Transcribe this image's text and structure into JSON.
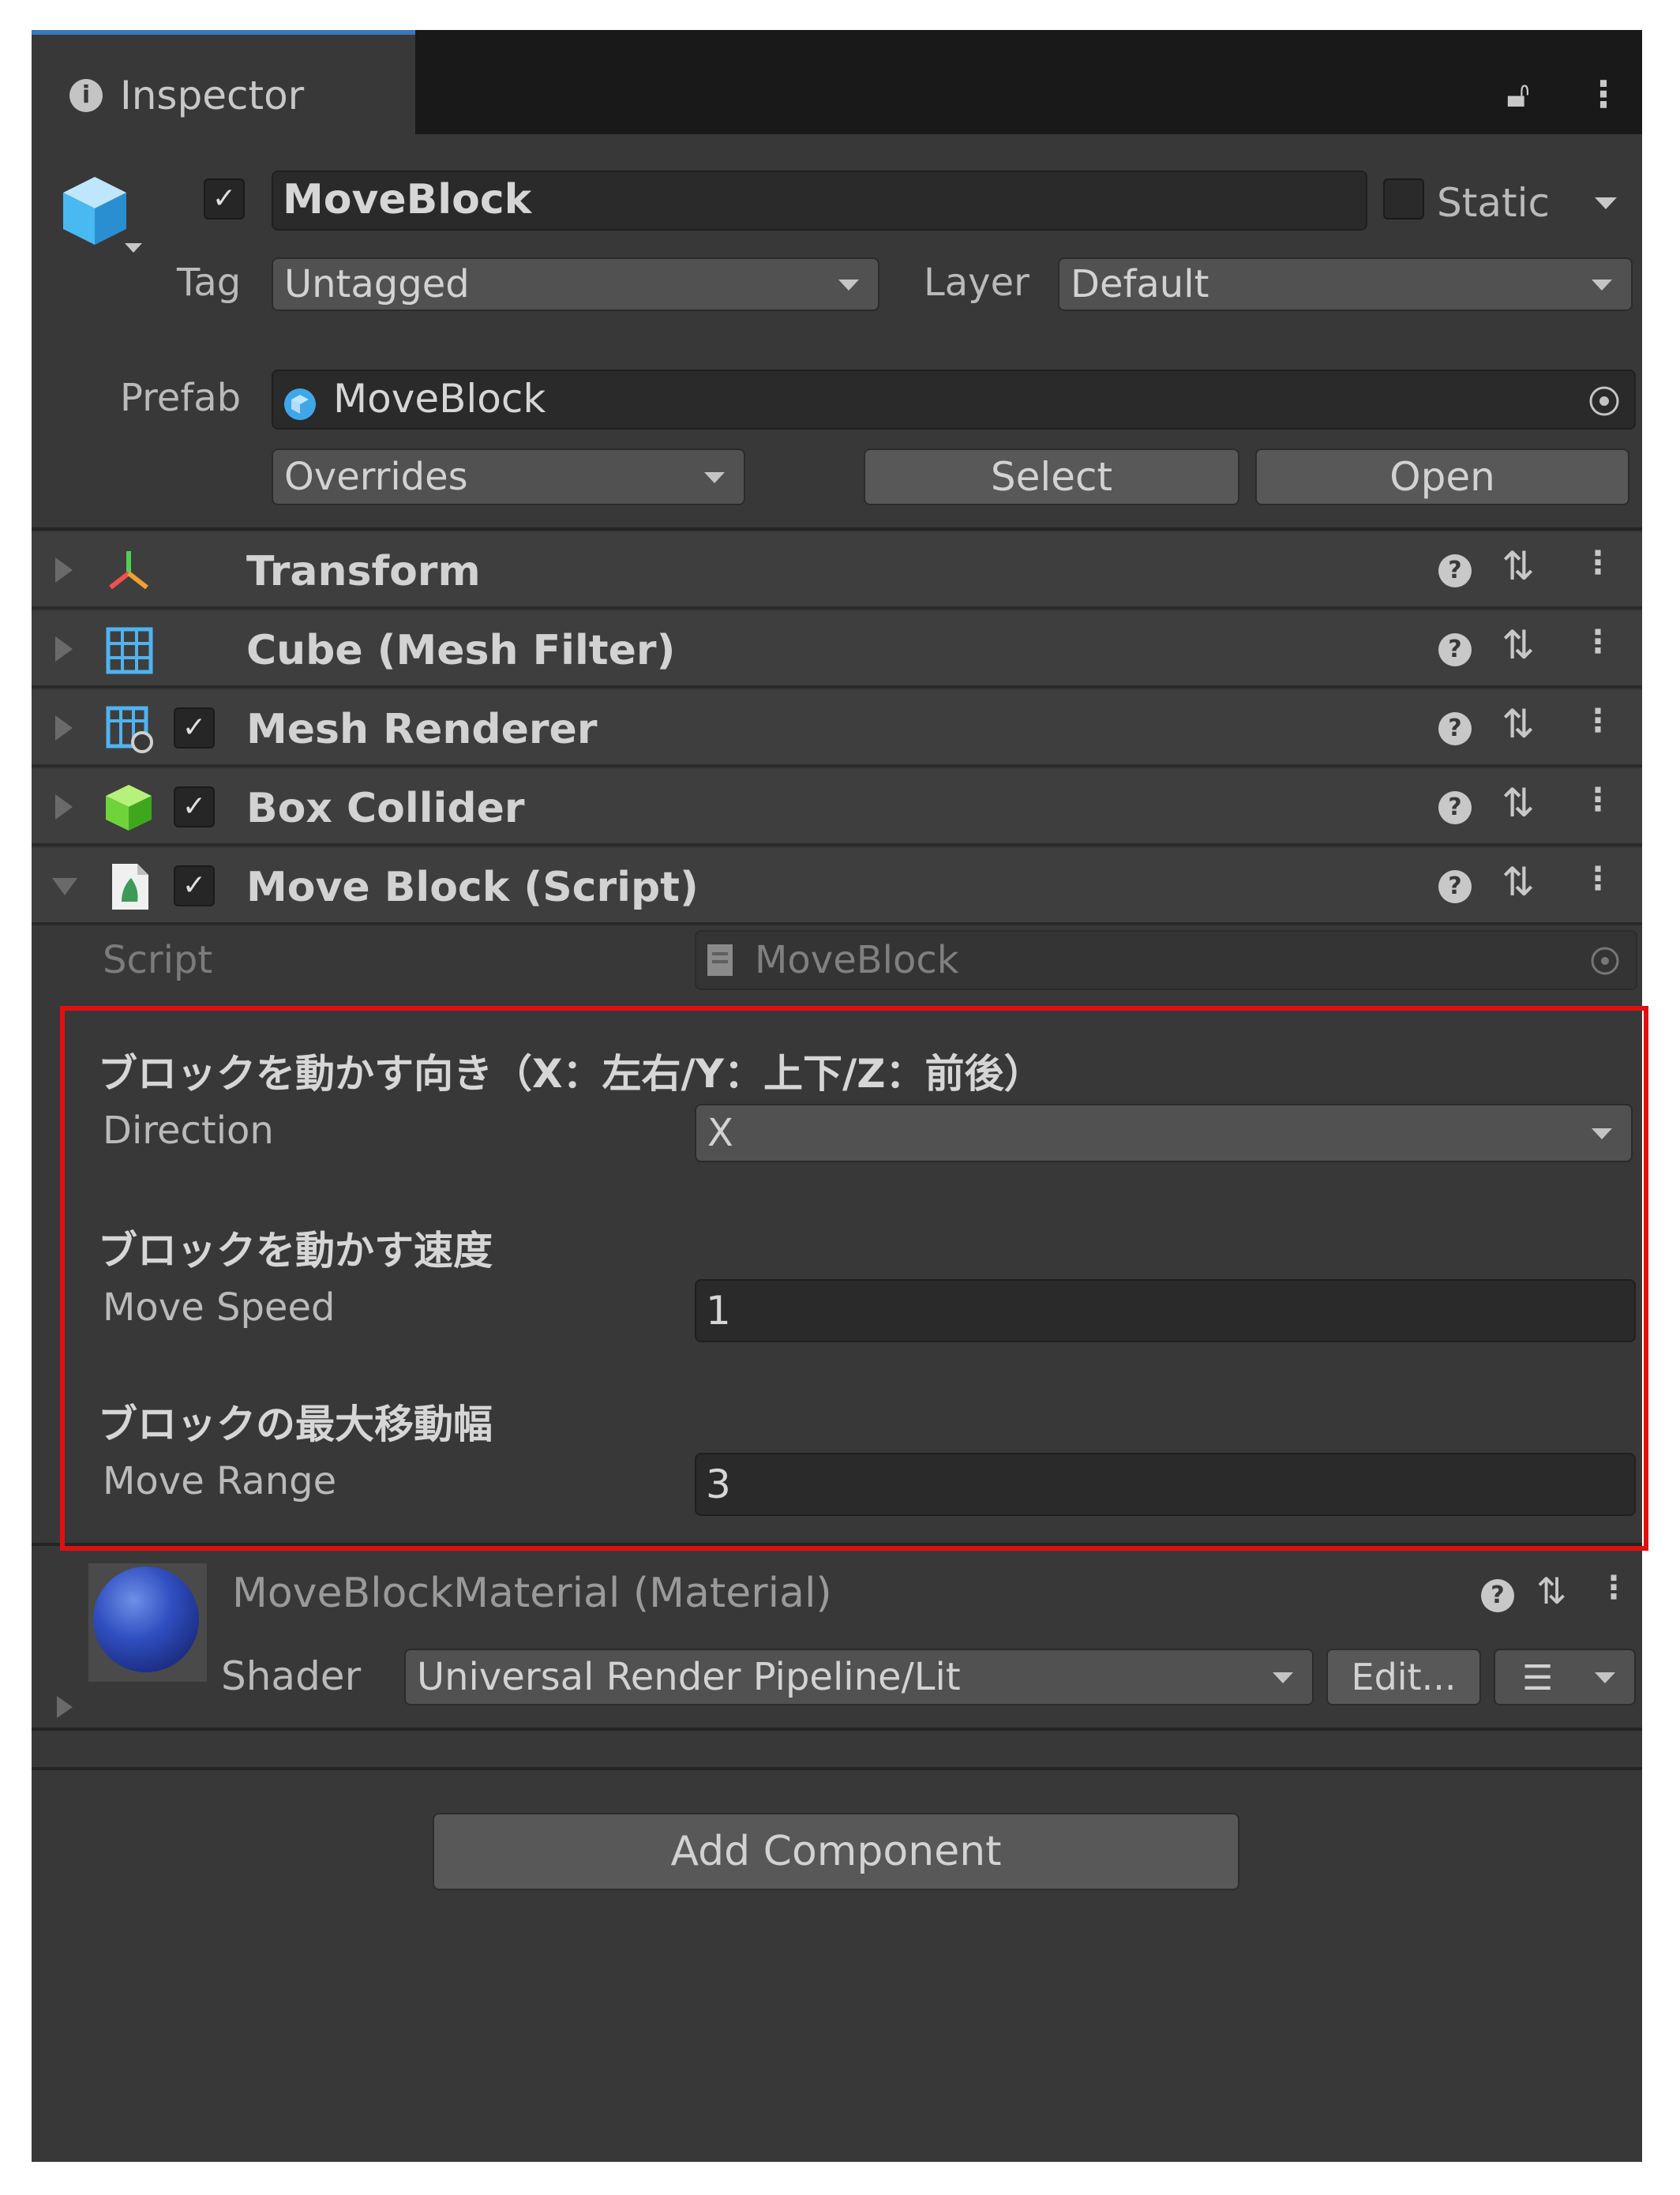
{
  "tab": {
    "title": "Inspector",
    "lock_icon": "lock-icon",
    "menu_icon": "kebab-menu-icon"
  },
  "gameobject": {
    "active": true,
    "name": "MoveBlock",
    "static_label": "Static",
    "tag_label": "Tag",
    "tag_value": "Untagged",
    "layer_label": "Layer",
    "layer_value": "Default",
    "icon": "cube-icon"
  },
  "prefab": {
    "label": "Prefab",
    "value": "MoveBlock",
    "overrides_label": "Overrides",
    "select_label": "Select",
    "open_label": "Open"
  },
  "components": [
    {
      "title": "Transform",
      "icon": "transform-icon",
      "expanded": false,
      "has_checkbox": false
    },
    {
      "title": "Cube (Mesh Filter)",
      "icon": "mesh-filter-icon",
      "expanded": false,
      "has_checkbox": false
    },
    {
      "title": "Mesh Renderer",
      "icon": "mesh-renderer-icon",
      "expanded": false,
      "has_checkbox": true
    },
    {
      "title": "Box Collider",
      "icon": "box-collider-icon",
      "expanded": false,
      "has_checkbox": true
    },
    {
      "title": "Move Block (Script)",
      "icon": "script-icon",
      "expanded": true,
      "has_checkbox": true
    }
  ],
  "script": {
    "script_label": "Script",
    "script_value": "MoveBlock",
    "direction_header": "ブロックを動かす向き（X：左右/Y：上下/Z：前後）",
    "direction_label": "Direction",
    "direction_value": "X",
    "speed_header": "ブロックを動かす速度",
    "speed_label": "Move Speed",
    "speed_value": "1",
    "range_header": "ブロックの最大移動幅",
    "range_label": "Move Range",
    "range_value": "3"
  },
  "material": {
    "title": "MoveBlockMaterial (Material)",
    "shader_label": "Shader",
    "shader_value": "Universal Render Pipeline/Lit",
    "edit_label": "Edit...",
    "list_icon": "list-icon"
  },
  "add_component_label": "Add Component",
  "colors": {
    "highlight_box": "#e01010",
    "panel_bg": "#383838",
    "tab_accent": "#3a79bb",
    "material_sphere": "#2f4fc0"
  }
}
